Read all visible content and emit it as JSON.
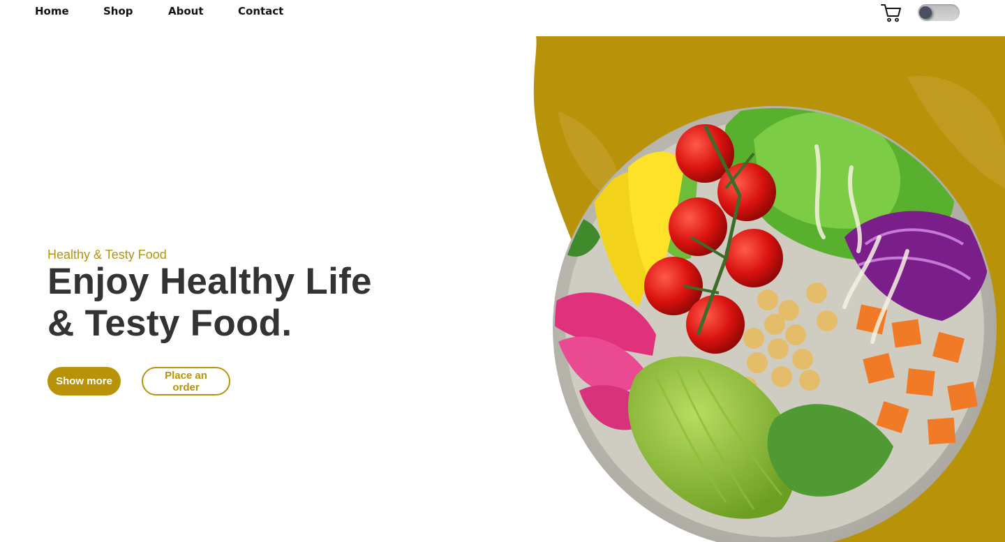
{
  "nav": {
    "items": [
      {
        "label": "Home"
      },
      {
        "label": "Shop"
      },
      {
        "label": "About"
      },
      {
        "label": "Contact"
      }
    ],
    "cart_icon": "cart-icon",
    "theme_toggle": {
      "state": "off"
    }
  },
  "hero": {
    "tagline": "Healthy & Testy Food",
    "headline_line1": "Enjoy Healthy Life",
    "headline_line2": "& Testy Food.",
    "primary_button": "Show more",
    "secondary_button": "Place an order",
    "image": "salad-bowl-image"
  },
  "colors": {
    "accent": "#b8930a",
    "heading": "#333333",
    "background": "#ffffff"
  }
}
